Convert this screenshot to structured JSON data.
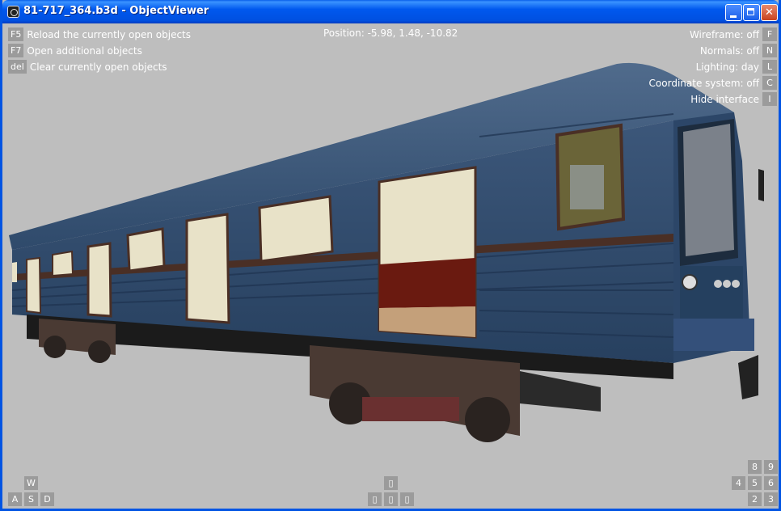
{
  "window": {
    "title": "81-717_364.b3d - ObjectViewer",
    "accent": "#0054e3",
    "close_color": "#c8431f"
  },
  "left_hints": [
    {
      "key": "F5",
      "label": "Reload the currently open objects"
    },
    {
      "key": "F7",
      "label": "Open additional objects"
    },
    {
      "key": "del",
      "label": "Clear currently open objects"
    }
  ],
  "position": "Position: -5.98, 1.48, -10.82",
  "right_hints": [
    {
      "label": "Wireframe: off",
      "key": "F"
    },
    {
      "label": "Normals: off",
      "key": "N"
    },
    {
      "label": "Lighting: day",
      "key": "L"
    },
    {
      "label": "Coordinate system: off",
      "key": "C"
    },
    {
      "label": "Hide interface",
      "key": "I"
    }
  ],
  "nav_left": {
    "up": "W",
    "left": "A",
    "down": "S",
    "right": "D"
  },
  "nav_center": {
    "up": "▯",
    "left": "▯",
    "mid": "▯",
    "right": "▯"
  },
  "nav_right": {
    "k8": "8",
    "k9": "9",
    "k4": "4",
    "k5": "5",
    "k6": "6",
    "k2": "2",
    "k3": "3"
  },
  "viewport_bg": "#bebebe",
  "train_color": "#2e4868"
}
